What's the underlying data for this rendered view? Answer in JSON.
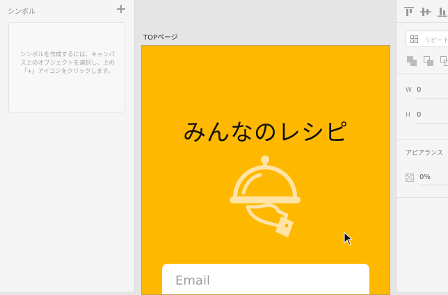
{
  "symbols_panel": {
    "title": "シンボル",
    "hint": "シンボルを作成するには、キャンバス上のオブジェクトを選択し、上の「+」アイコンをクリックします。"
  },
  "canvas": {
    "artboard_name": "TOPページ",
    "artboard_color": "#ffb800",
    "app_title": "みんなのレシピ",
    "email_placeholder": "Email",
    "illustration_icon": "serving-cloche-icon"
  },
  "inspector": {
    "repeat_grid_label": "リピート",
    "width_label": "W",
    "width_value": "0",
    "height_label": "H",
    "height_value": "0",
    "appearance_label": "アピアランス",
    "opacity_value": "0%"
  }
}
